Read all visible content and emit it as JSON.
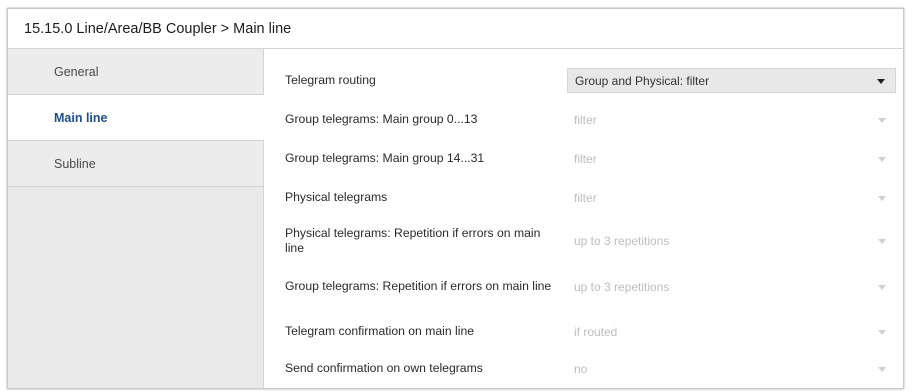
{
  "window": {
    "title": "15.15.0 Line/Area/BB Coupler > Main line"
  },
  "sidebar": {
    "items": [
      {
        "label": "General",
        "active": false
      },
      {
        "label": "Main line",
        "active": true
      },
      {
        "label": "Subline",
        "active": false
      }
    ]
  },
  "main": {
    "rows": [
      {
        "label": "Telegram routing",
        "value": "Group and Physical: filter",
        "enabled": true
      },
      {
        "label": "Group telegrams: Main group 0...13",
        "value": "filter",
        "enabled": false
      },
      {
        "label": "Group telegrams: Main group 14...31",
        "value": "filter",
        "enabled": false
      },
      {
        "label": "Physical telegrams",
        "value": "filter",
        "enabled": false
      },
      {
        "label": "Physical telegrams: Repetition if errors on main line",
        "value": "up to 3 repetitions",
        "enabled": false
      },
      {
        "label": "Group telegrams: Repetition if errors on main line",
        "value": "up to 3 repetitions",
        "enabled": false
      },
      {
        "label": "Telegram confirmation on main line",
        "value": "if routed",
        "enabled": false
      },
      {
        "label": "Send confirmation on own telegrams",
        "value": "no",
        "enabled": false
      }
    ]
  },
  "icons": {
    "dropdown": "chevron-down-icon"
  },
  "colors": {
    "active_tab_text": "#1f4e8c",
    "sidebar_bg": "#e9e9e9",
    "disabled_text": "#bdbdbd"
  }
}
